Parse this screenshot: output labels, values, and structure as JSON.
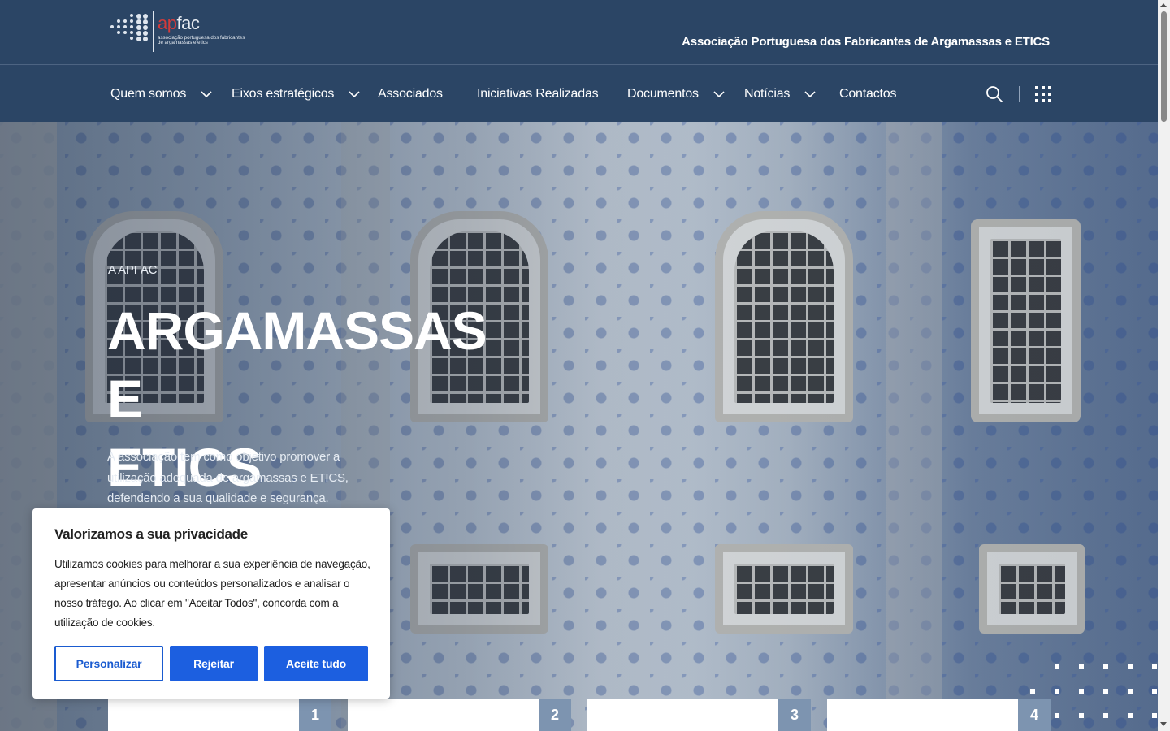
{
  "header": {
    "logo": {
      "word_accent": "ap",
      "word_rest": "fac",
      "subtitle": "associação portuguesa dos fabricantes de argamassas e etics"
    },
    "org_name": "Associação Portuguesa dos Fabricantes de Argamassas e ETICS"
  },
  "nav": {
    "items": [
      {
        "label": "Quem somos",
        "has_dropdown": true
      },
      {
        "label": "Eixos estratégicos",
        "has_dropdown": true
      },
      {
        "label": "Associados",
        "has_dropdown": false
      },
      {
        "label": "Iniciativas Realizadas",
        "has_dropdown": false
      },
      {
        "label": "Documentos",
        "has_dropdown": true
      },
      {
        "label": "Notícias",
        "has_dropdown": true
      },
      {
        "label": "Contactos",
        "has_dropdown": false
      }
    ],
    "search_icon": "search-icon",
    "apps_icon": "grid-menu-icon"
  },
  "hero": {
    "eyebrow": "A APFAC",
    "title_line1": "ARGAMASSAS E",
    "title_line2": "ETICS",
    "description": "A associação tem como objetivo promover a utilização adequada de argamassas e ETICS, defendendo a sua qualidade e segurança. Conheça"
  },
  "steps": [
    "1",
    "2",
    "3",
    "4"
  ],
  "cookie": {
    "title": "Valorizamos a sua privacidade",
    "text": "Utilizamos cookies para melhorar a sua experiência de navegação, apresentar anúncios ou conteúdos personalizados e analisar o nosso tráfego. Ao clicar em \"Aceitar Todos\", concorda com a utilização de cookies.",
    "buttons": {
      "customize": "Personalizar",
      "reject": "Rejeitar",
      "accept": "Aceite tudo"
    }
  },
  "colors": {
    "header_bg": "#2b4565",
    "primary_button": "#1c5fe0",
    "step_badge": "#7d94b0",
    "logo_accent": "#d23b3b"
  }
}
